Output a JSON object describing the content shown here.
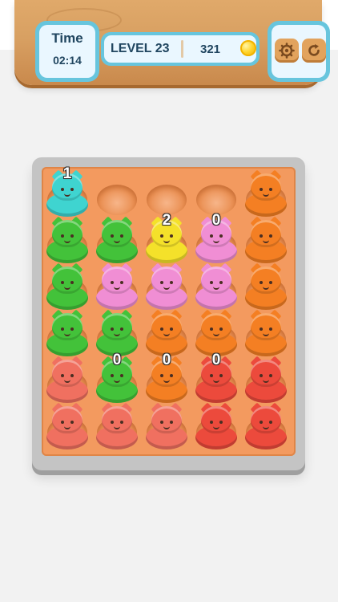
{
  "header": {
    "time_label": "Time",
    "time_value": "02:14",
    "level_label": "LEVEL 23",
    "coins": "321",
    "coin_icon": "coin-icon",
    "settings_icon": "gear-icon",
    "restart_icon": "restart-icon"
  },
  "colors": {
    "cyan": "#3fd4d0",
    "green": "#43c23a",
    "yellow": "#f4e12a",
    "pink": "#f08ed4",
    "orange": "#f47f23",
    "salmon": "#f07060",
    "red": "#ec4a3c"
  },
  "board": {
    "rows": 6,
    "cols": 5,
    "grid": [
      [
        "cyan",
        null,
        null,
        null,
        "orange"
      ],
      [
        "green",
        "green",
        "yellow",
        "pink",
        "orange"
      ],
      [
        "green",
        "pink",
        "pink",
        "pink",
        "orange"
      ],
      [
        "green",
        "green",
        "orange",
        "orange",
        "orange"
      ],
      [
        "salmon",
        "green",
        "orange",
        "red",
        "red"
      ],
      [
        "salmon",
        "salmon",
        "salmon",
        "red",
        "red"
      ]
    ],
    "badges": [
      {
        "row": 0,
        "col": 0,
        "text": "1"
      },
      {
        "row": 1,
        "col": 2,
        "text": "2"
      },
      {
        "row": 1,
        "col": 3,
        "text": "0"
      },
      {
        "row": 4,
        "col": 1,
        "text": "0"
      },
      {
        "row": 4,
        "col": 2,
        "text": "0"
      },
      {
        "row": 4,
        "col": 3,
        "text": "0"
      }
    ]
  }
}
